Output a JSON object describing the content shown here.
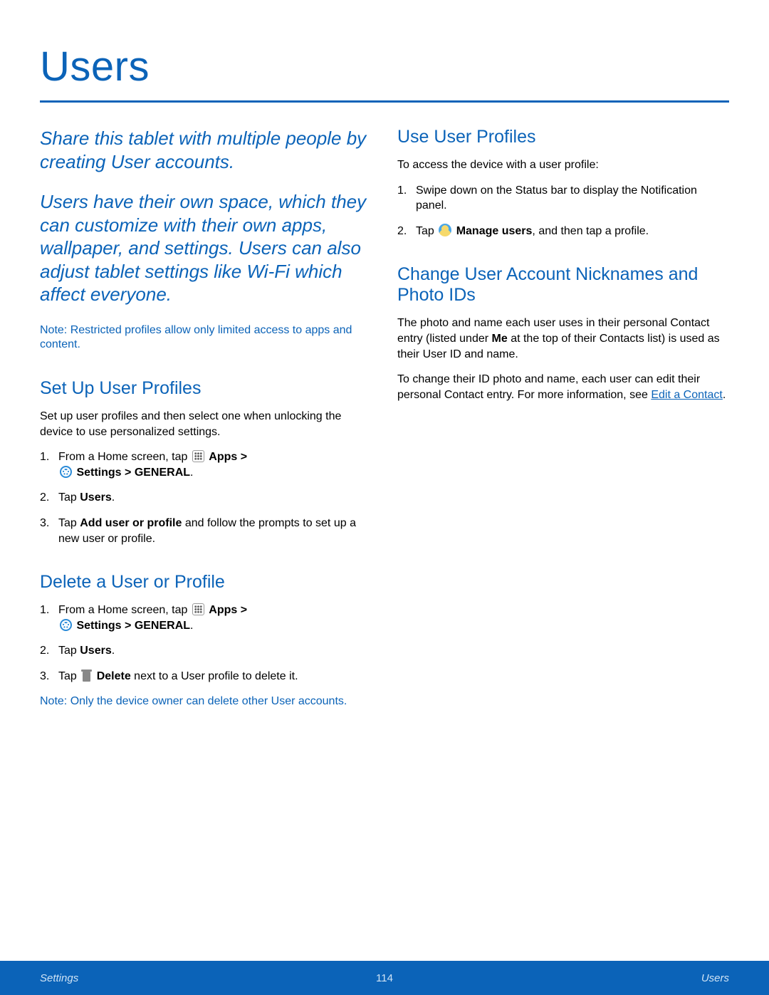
{
  "page_title": "Users",
  "intro_p1": "Share this tablet with multiple people by creating User accounts.",
  "intro_p2": "Users have their own space, which they can customize with their own apps, wallpaper, and settings. Users can also adjust tablet settings like Wi-Fi which affect everyone.",
  "note_top_label": "Note",
  "note_top_body": ": Restricted profiles allow only limited access to apps and content.",
  "setup": {
    "heading": "Set Up User Profiles",
    "intro": "Set up user profiles and then select one when unlocking the device to use personalized settings.",
    "step1_pre": "From a Home screen, tap ",
    "apps_label": "Apps",
    "gt": " > ",
    "settings_label": "Settings",
    "general_label": "  > GENERAL",
    "period": ".",
    "step2_pre": "Tap ",
    "step2_bold": "Users",
    "step3_pre": "Tap ",
    "step3_bold": "Add user or profile",
    "step3_post": " and follow the prompts to set up a new user or profile."
  },
  "delete": {
    "heading": "Delete a User or Profile",
    "step1_pre": "From a Home screen, tap ",
    "step2_pre": "Tap ",
    "step2_bold": "Users",
    "step3_pre": "Tap ",
    "step3_bold": " Delete",
    "step3_post": " next to a User profile to delete it.",
    "note_label": "Note",
    "note_body": ": Only the device owner can delete other User accounts."
  },
  "use": {
    "heading": "Use User Profiles",
    "intro": "To access the device with a user profile:",
    "step1": "Swipe down on the Status bar to display the Notification panel.",
    "step2_pre": "Tap ",
    "step2_bold": " Manage users",
    "step2_post": ", and then tap a profile."
  },
  "change": {
    "heading": "Change User Account Nicknames and Photo IDs",
    "p1_pre": "The photo and name each user uses in their personal Contact entry (listed under ",
    "p1_bold": "Me",
    "p1_post": " at the top of their Contacts list) is used as their User ID and name.",
    "p2_pre": "To change their ID photo and name, each user can edit their personal Contact entry. For more information, see ",
    "p2_link": "Edit a Contact",
    "p2_post": "."
  },
  "footer": {
    "left": "Settings",
    "center": "114",
    "right": "Users"
  }
}
